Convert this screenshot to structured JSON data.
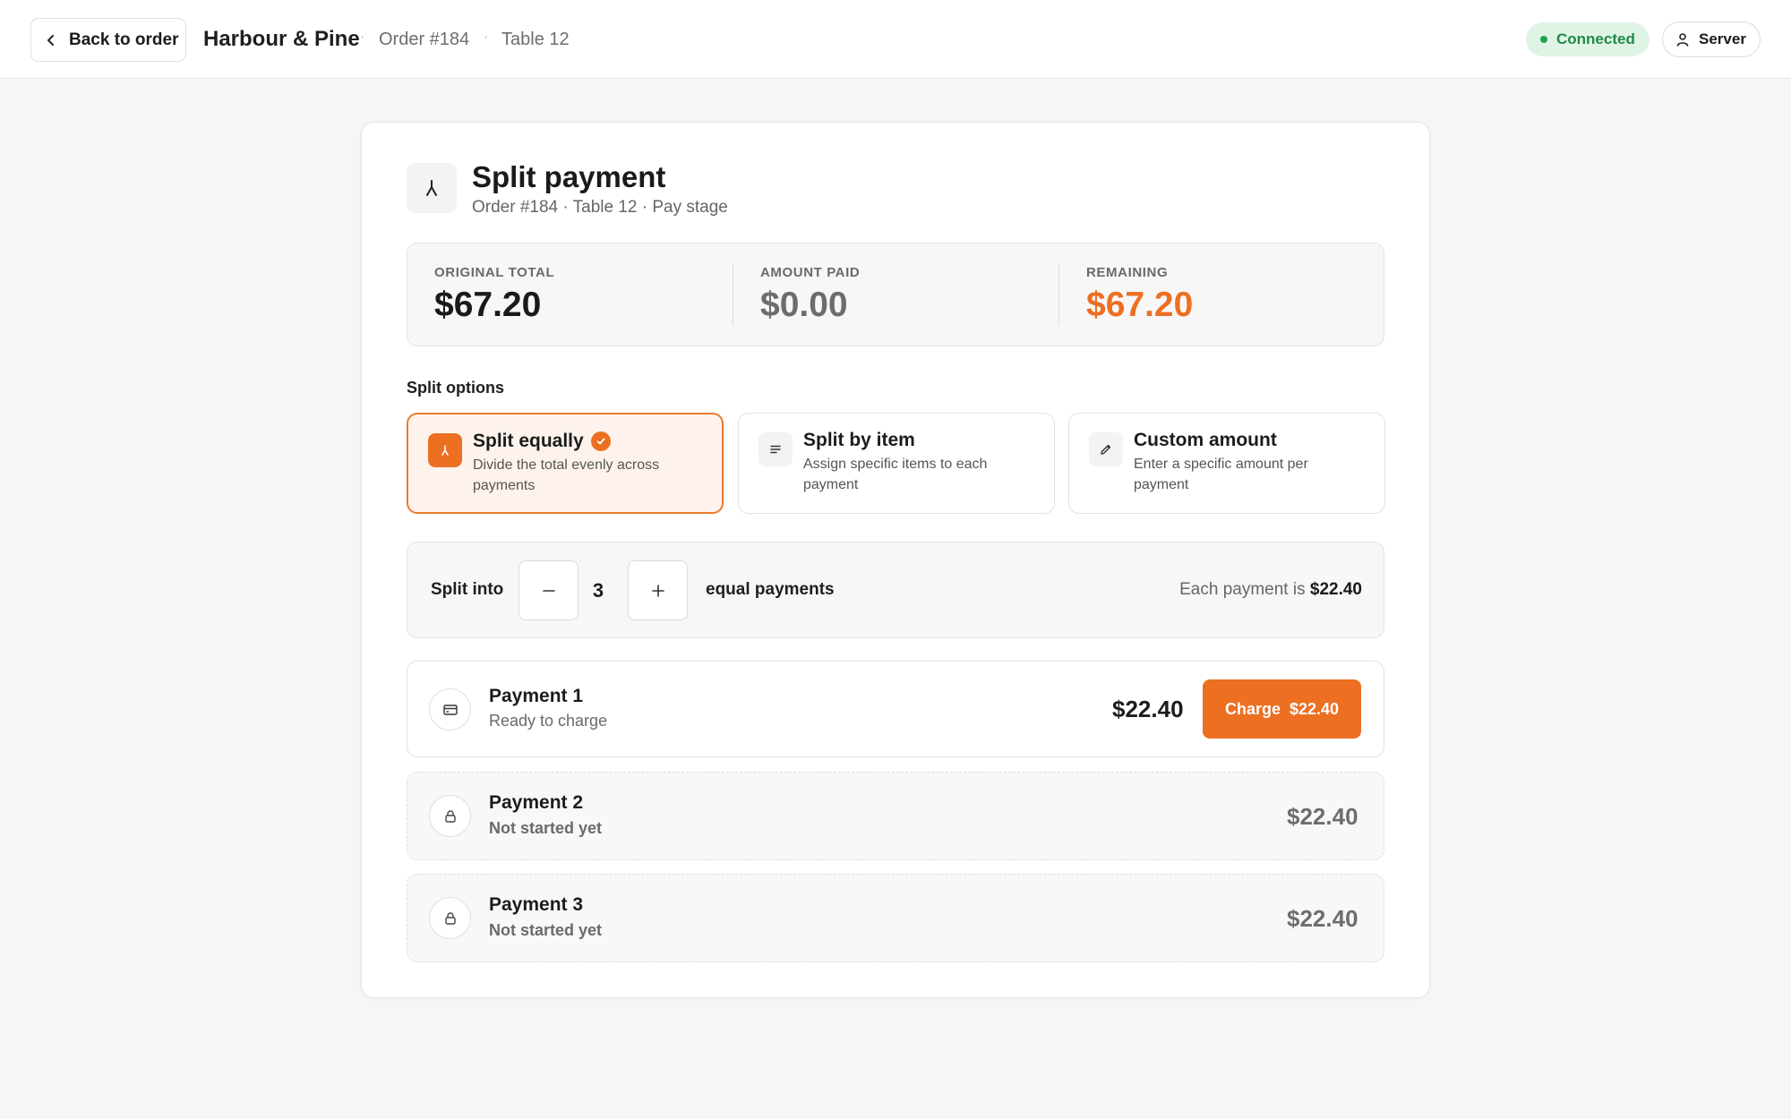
{
  "topbar": {
    "back_label": "Back to order",
    "brand": "Harbour & Pine",
    "order": "Order #184",
    "table": "Table 12",
    "status": "Connected",
    "user": "Server"
  },
  "header": {
    "title": "Split payment",
    "subtitle": "Order #184 · Table 12 · Pay stage"
  },
  "totals": [
    {
      "label": "ORIGINAL TOTAL",
      "value": "$67.20",
      "color": "#1a1a1a"
    },
    {
      "label": "AMOUNT PAID",
      "value": "$0.00",
      "color": "#6d6d6d"
    },
    {
      "label": "REMAINING",
      "value": "$67.20",
      "color": "#ec6f22"
    }
  ],
  "split_options": {
    "label": "Split options",
    "items": [
      {
        "title": "Split equally",
        "desc": "Divide the total evenly across payments",
        "selected": true
      },
      {
        "title": "Split by item",
        "desc": "Assign specific items to each payment",
        "selected": false
      },
      {
        "title": "Custom amount",
        "desc": "Enter a specific amount per payment",
        "selected": false
      }
    ]
  },
  "split_into": {
    "label": "Split into",
    "count": "3",
    "suffix": "equal payments",
    "each_prefix": "Each payment is",
    "each_amount": "$22.40"
  },
  "payments": [
    {
      "title": "Payment 1",
      "status": "Ready to charge",
      "amount": "$22.40",
      "charge_label": "Charge",
      "charge_amount": "$22.40",
      "icon": "card-icon"
    },
    {
      "title": "Payment 2",
      "status": "Not started yet",
      "amount": "$22.40",
      "icon": "lock-icon"
    },
    {
      "title": "Payment 3",
      "status": "Not started yet",
      "amount": "$22.40",
      "icon": "lock-icon"
    }
  ],
  "colors": {
    "accent": "#ec6f22",
    "success": "#1f8a47",
    "success_bg": "#e0f4e6"
  }
}
